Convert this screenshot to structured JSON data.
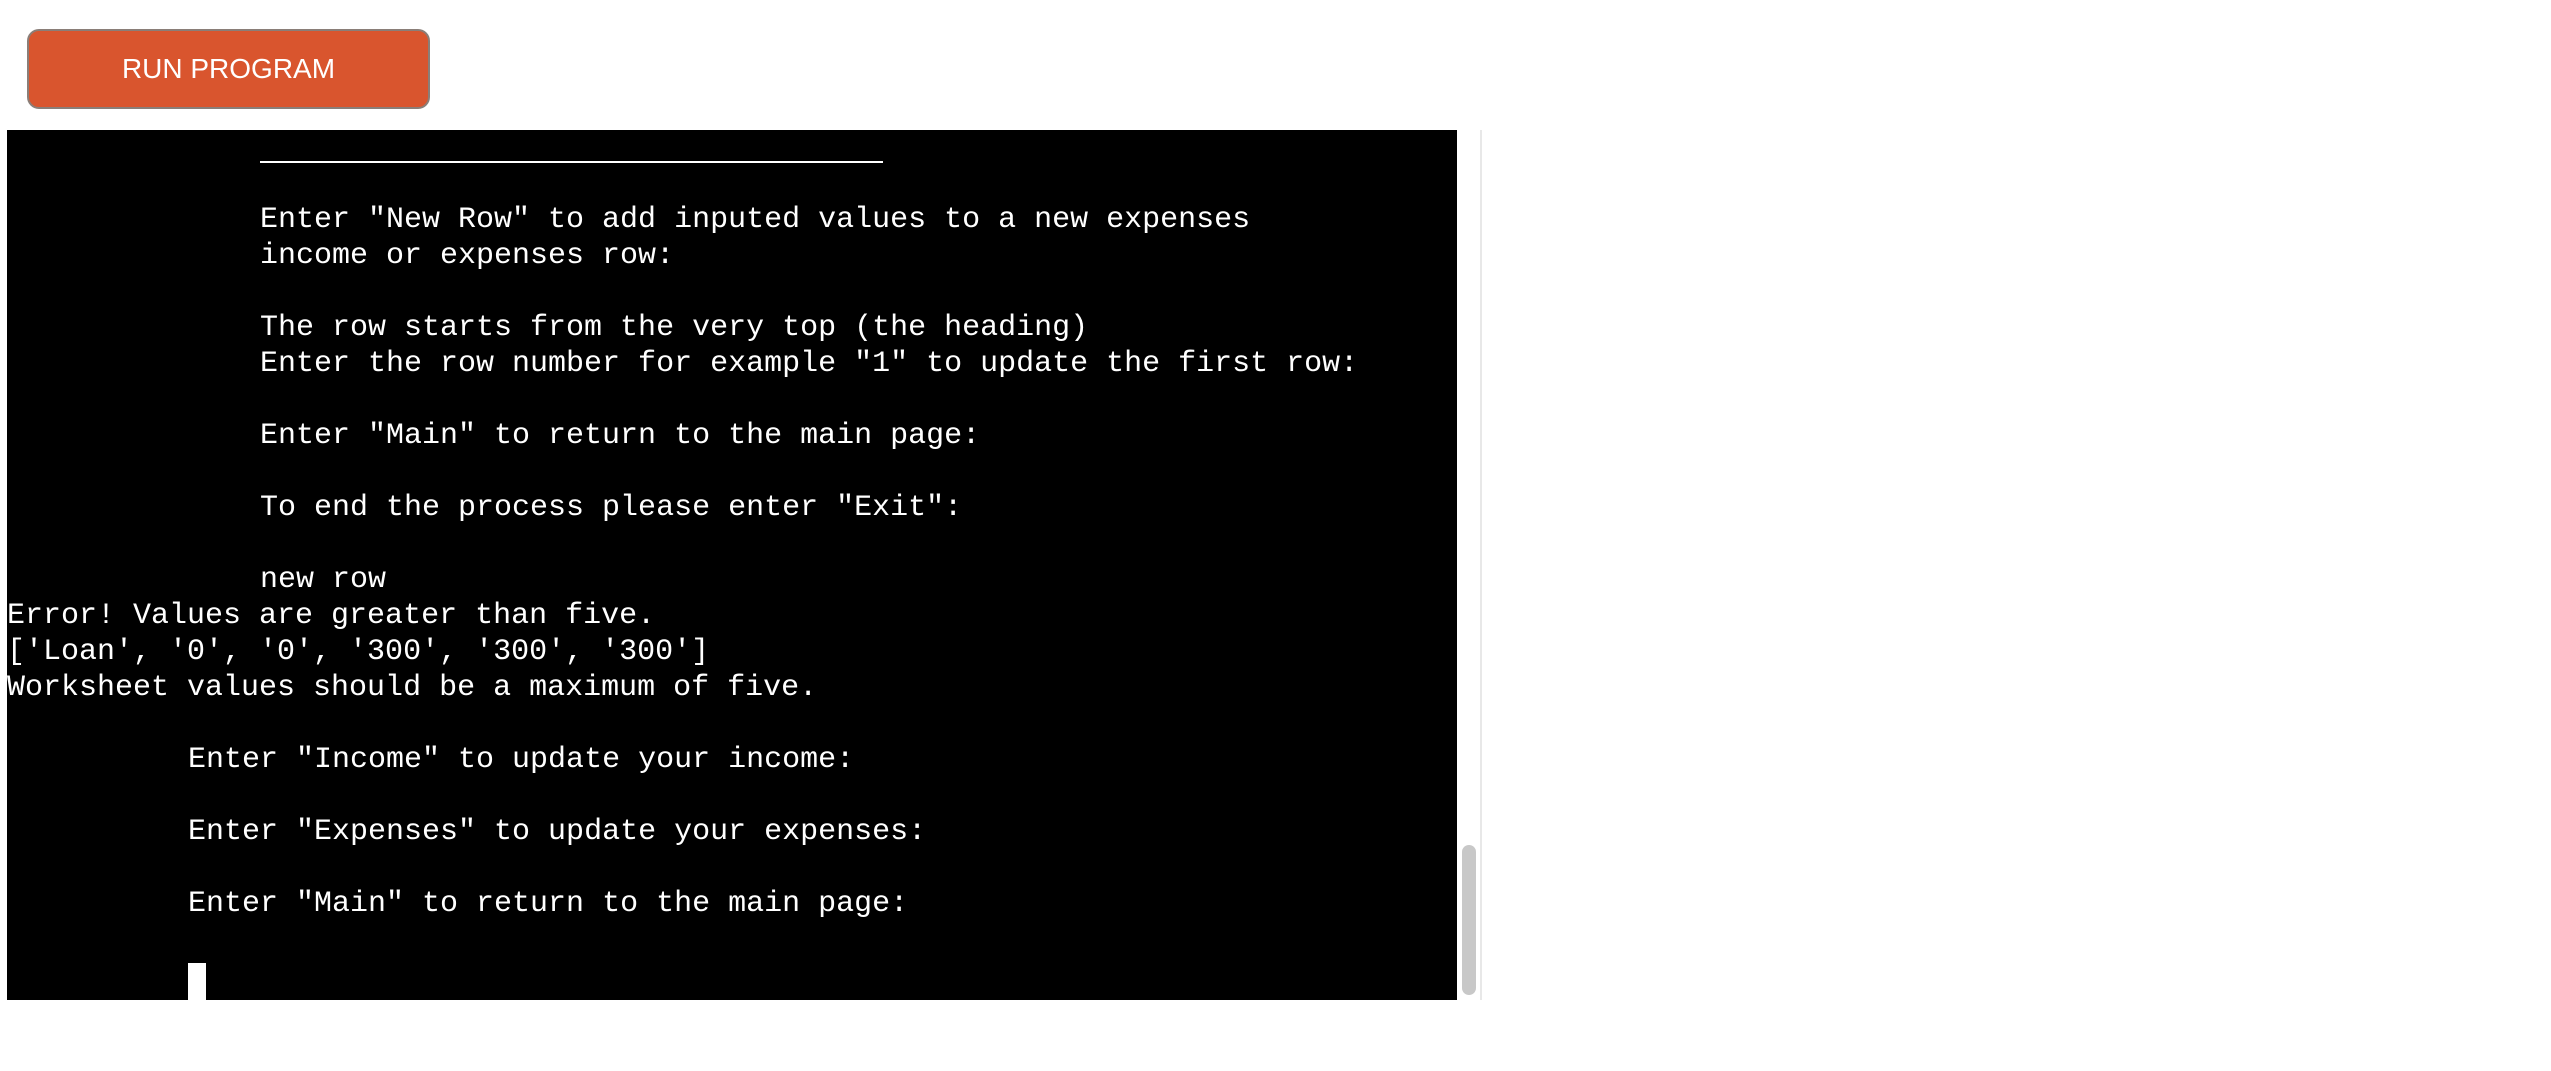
{
  "toolbar": {
    "run_label": "RUN PROGRAM",
    "run_color": "#d9552e"
  },
  "terminal": {
    "background": "#000000",
    "foreground": "#ffffff",
    "lines": [
      "Enter \"New Row\" to add inputed values to a new expenses",
      "income or expenses row:",
      "The row starts from the very top (the heading)",
      "Enter the row number for example \"1\" to update the first row:",
      "Enter \"Main\" to return to the main page:",
      "To end the process please enter \"Exit\":",
      "new row",
      "Error! Values are greater than five.",
      "['Loan', '0', '0', '300', '300', '300']",
      "Worksheet values should be a maximum of five.",
      "Enter \"Income\" to update your income:",
      "Enter \"Expenses\" to update your expenses:",
      "Enter \"Main\" to return to the main page:"
    ]
  }
}
